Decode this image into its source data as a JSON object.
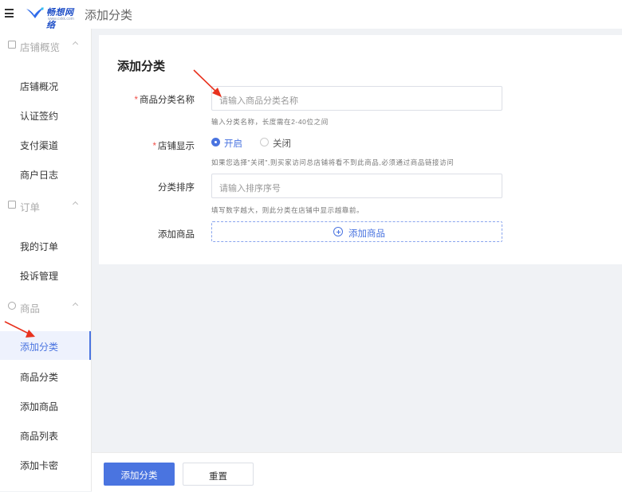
{
  "header": {
    "brand_name": "畅想网络",
    "brand_url": "www.cxkk.com",
    "page_title": "添加分类"
  },
  "sidebar": {
    "groups": [
      {
        "label": "店铺概览",
        "items": [
          "店铺概况",
          "认证签约",
          "支付渠道",
          "商户日志"
        ]
      },
      {
        "label": "订单",
        "items": [
          "我的订单",
          "投诉管理"
        ]
      },
      {
        "label": "商品",
        "items": [
          "添加分类",
          "商品分类",
          "添加商品",
          "商品列表",
          "添加卡密"
        ]
      }
    ],
    "active_item": "添加分类"
  },
  "form": {
    "title": "添加分类",
    "required_mark": "*",
    "fields": {
      "name": {
        "label": "商品分类名称",
        "placeholder": "请输入商品分类名称",
        "hint": "输入分类名称，长度需在2-40位之间"
      },
      "display": {
        "label": "店铺显示",
        "options": [
          "开启",
          "关闭"
        ],
        "selected": "开启",
        "hint": "如果您选择\"关闭\",则买家访问总店铺将看不到此商品,必须通过商品链接访问"
      },
      "sort": {
        "label": "分类排序",
        "placeholder": "请输入排序序号",
        "hint": "填写数字越大，则此分类在店铺中显示越靠前。"
      },
      "goods": {
        "label": "添加商品",
        "button_label": "添加商品"
      }
    }
  },
  "footer": {
    "submit_label": "添加分类",
    "reset_label": "重置"
  },
  "colors": {
    "primary": "#4a74e0",
    "required": "#f0504a",
    "annotation_arrow": "#e8321e"
  }
}
